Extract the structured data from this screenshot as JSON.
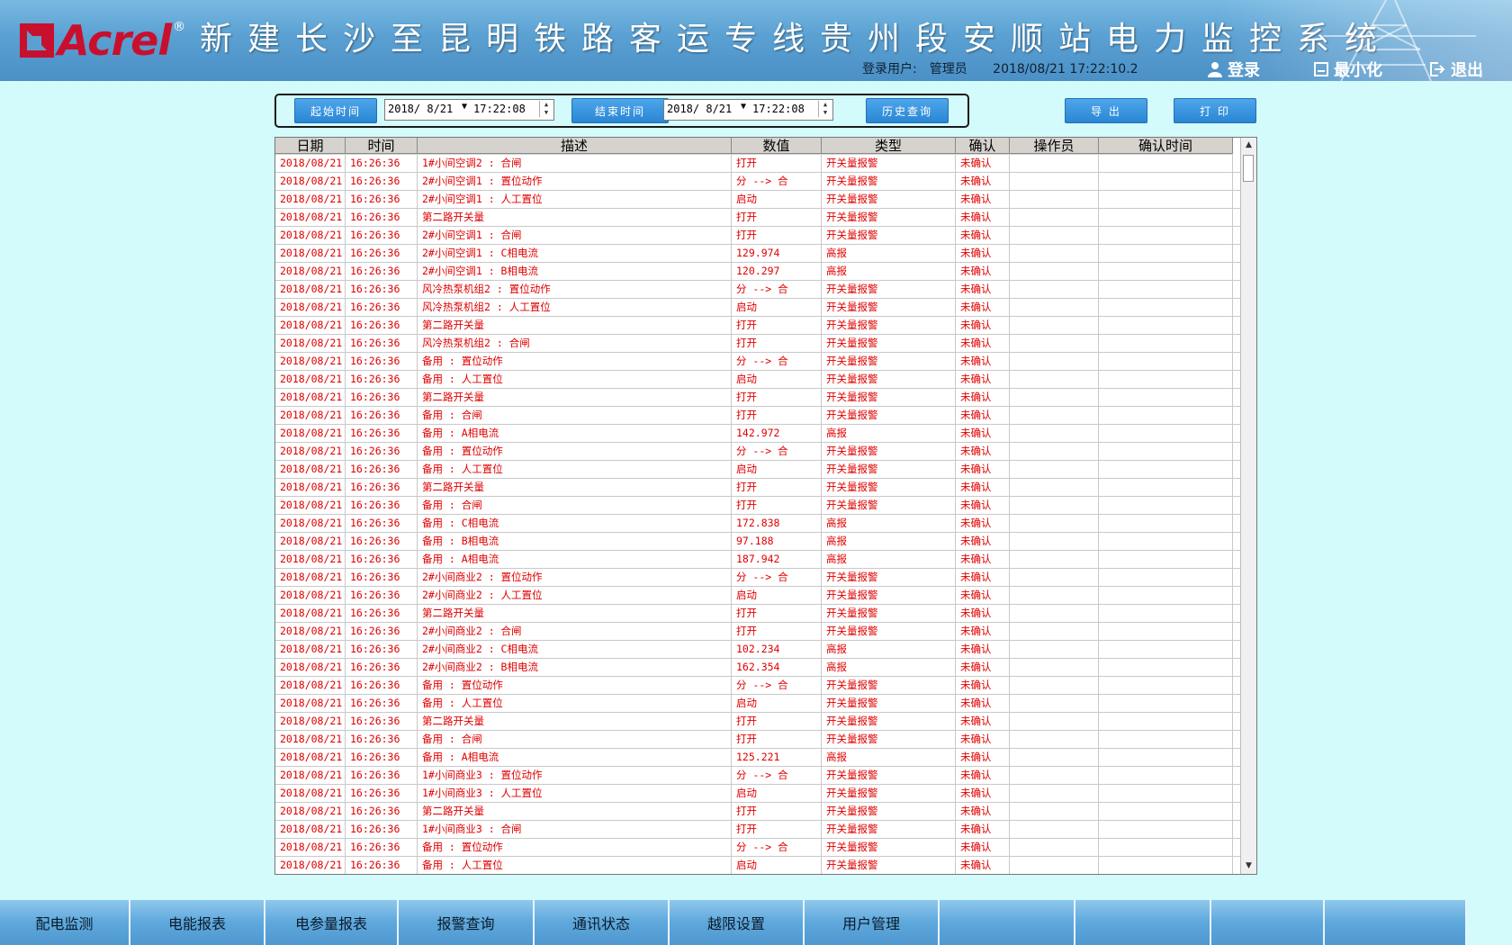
{
  "header": {
    "logo_text": "Acrel",
    "logo_reg": "®",
    "title": "新建长沙至昆明铁路客运专线贵州段安顺站电力监控系统",
    "user_label": "登录用户:",
    "user_name": "管理员",
    "datetime": "2018/08/21   17:22:10.2",
    "login_label": "登录",
    "minimize_label": "最小化",
    "exit_label": "退出"
  },
  "query": {
    "start_button": "起始时间",
    "start_date": "2018/ 8/21",
    "start_time": "17:22:08",
    "end_button": "结束时间",
    "end_date": "2018/ 8/21",
    "end_time": "17:22:08",
    "history_button": "历史查询",
    "export_button": "导 出",
    "print_button": "打 印"
  },
  "table": {
    "columns": [
      "日期",
      "时间",
      "描述",
      "数值",
      "类型",
      "确认",
      "操作员",
      "确认时间"
    ],
    "rows": [
      [
        "2018/08/21",
        "16:26:36",
        "1#小间空调2 : 合闸",
        "打开",
        "开关量报警",
        "未确认",
        "",
        ""
      ],
      [
        "2018/08/21",
        "16:26:36",
        "2#小间空调1 : 置位动作",
        "分 --> 合",
        "开关量报警",
        "未确认",
        "",
        ""
      ],
      [
        "2018/08/21",
        "16:26:36",
        "2#小间空调1 : 人工置位",
        "启动",
        "开关量报警",
        "未确认",
        "",
        ""
      ],
      [
        "2018/08/21",
        "16:26:36",
        "第二路开关量",
        "打开",
        "开关量报警",
        "未确认",
        "",
        ""
      ],
      [
        "2018/08/21",
        "16:26:36",
        "2#小间空调1 : 合闸",
        "打开",
        "开关量报警",
        "未确认",
        "",
        ""
      ],
      [
        "2018/08/21",
        "16:26:36",
        "2#小间空调1 : C相电流",
        "129.974",
        "高报",
        "未确认",
        "",
        ""
      ],
      [
        "2018/08/21",
        "16:26:36",
        "2#小间空调1 : B相电流",
        "120.297",
        "高报",
        "未确认",
        "",
        ""
      ],
      [
        "2018/08/21",
        "16:26:36",
        "风冷热泵机组2 : 置位动作",
        "分 --> 合",
        "开关量报警",
        "未确认",
        "",
        ""
      ],
      [
        "2018/08/21",
        "16:26:36",
        "风冷热泵机组2 : 人工置位",
        "启动",
        "开关量报警",
        "未确认",
        "",
        ""
      ],
      [
        "2018/08/21",
        "16:26:36",
        "第二路开关量",
        "打开",
        "开关量报警",
        "未确认",
        "",
        ""
      ],
      [
        "2018/08/21",
        "16:26:36",
        "风冷热泵机组2 : 合闸",
        "打开",
        "开关量报警",
        "未确认",
        "",
        ""
      ],
      [
        "2018/08/21",
        "16:26:36",
        "备用 : 置位动作",
        "分 --> 合",
        "开关量报警",
        "未确认",
        "",
        ""
      ],
      [
        "2018/08/21",
        "16:26:36",
        "备用 : 人工置位",
        "启动",
        "开关量报警",
        "未确认",
        "",
        ""
      ],
      [
        "2018/08/21",
        "16:26:36",
        "第二路开关量",
        "打开",
        "开关量报警",
        "未确认",
        "",
        ""
      ],
      [
        "2018/08/21",
        "16:26:36",
        "备用 : 合闸",
        "打开",
        "开关量报警",
        "未确认",
        "",
        ""
      ],
      [
        "2018/08/21",
        "16:26:36",
        "备用 : A相电流",
        "142.972",
        "高报",
        "未确认",
        "",
        ""
      ],
      [
        "2018/08/21",
        "16:26:36",
        "备用 : 置位动作",
        "分 --> 合",
        "开关量报警",
        "未确认",
        "",
        ""
      ],
      [
        "2018/08/21",
        "16:26:36",
        "备用 : 人工置位",
        "启动",
        "开关量报警",
        "未确认",
        "",
        ""
      ],
      [
        "2018/08/21",
        "16:26:36",
        "第二路开关量",
        "打开",
        "开关量报警",
        "未确认",
        "",
        ""
      ],
      [
        "2018/08/21",
        "16:26:36",
        "备用 : 合闸",
        "打开",
        "开关量报警",
        "未确认",
        "",
        ""
      ],
      [
        "2018/08/21",
        "16:26:36",
        "备用 : C相电流",
        "172.838",
        "高报",
        "未确认",
        "",
        ""
      ],
      [
        "2018/08/21",
        "16:26:36",
        "备用 : B相电流",
        "97.188",
        "高报",
        "未确认",
        "",
        ""
      ],
      [
        "2018/08/21",
        "16:26:36",
        "备用 : A相电流",
        "187.942",
        "高报",
        "未确认",
        "",
        ""
      ],
      [
        "2018/08/21",
        "16:26:36",
        "2#小间商业2 : 置位动作",
        "分 --> 合",
        "开关量报警",
        "未确认",
        "",
        ""
      ],
      [
        "2018/08/21",
        "16:26:36",
        "2#小间商业2 : 人工置位",
        "启动",
        "开关量报警",
        "未确认",
        "",
        ""
      ],
      [
        "2018/08/21",
        "16:26:36",
        "第二路开关量",
        "打开",
        "开关量报警",
        "未确认",
        "",
        ""
      ],
      [
        "2018/08/21",
        "16:26:36",
        "2#小间商业2 : 合闸",
        "打开",
        "开关量报警",
        "未确认",
        "",
        ""
      ],
      [
        "2018/08/21",
        "16:26:36",
        "2#小间商业2 : C相电流",
        "102.234",
        "高报",
        "未确认",
        "",
        ""
      ],
      [
        "2018/08/21",
        "16:26:36",
        "2#小间商业2 : B相电流",
        "162.354",
        "高报",
        "未确认",
        "",
        ""
      ],
      [
        "2018/08/21",
        "16:26:36",
        "备用 : 置位动作",
        "分 --> 合",
        "开关量报警",
        "未确认",
        "",
        ""
      ],
      [
        "2018/08/21",
        "16:26:36",
        "备用 : 人工置位",
        "启动",
        "开关量报警",
        "未确认",
        "",
        ""
      ],
      [
        "2018/08/21",
        "16:26:36",
        "第二路开关量",
        "打开",
        "开关量报警",
        "未确认",
        "",
        ""
      ],
      [
        "2018/08/21",
        "16:26:36",
        "备用 : 合闸",
        "打开",
        "开关量报警",
        "未确认",
        "",
        ""
      ],
      [
        "2018/08/21",
        "16:26:36",
        "备用 : A相电流",
        "125.221",
        "高报",
        "未确认",
        "",
        ""
      ],
      [
        "2018/08/21",
        "16:26:36",
        "1#小间商业3 : 置位动作",
        "分 --> 合",
        "开关量报警",
        "未确认",
        "",
        ""
      ],
      [
        "2018/08/21",
        "16:26:36",
        "1#小间商业3 : 人工置位",
        "启动",
        "开关量报警",
        "未确认",
        "",
        ""
      ],
      [
        "2018/08/21",
        "16:26:36",
        "第二路开关量",
        "打开",
        "开关量报警",
        "未确认",
        "",
        ""
      ],
      [
        "2018/08/21",
        "16:26:36",
        "1#小间商业3 : 合闸",
        "打开",
        "开关量报警",
        "未确认",
        "",
        ""
      ],
      [
        "2018/08/21",
        "16:26:36",
        "备用 : 置位动作",
        "分 --> 合",
        "开关量报警",
        "未确认",
        "",
        ""
      ],
      [
        "2018/08/21",
        "16:26:36",
        "备用 : 人工置位",
        "启动",
        "开关量报警",
        "未确认",
        "",
        ""
      ]
    ]
  },
  "nav": {
    "tabs": [
      "配电监测",
      "电能报表",
      "电参量报表",
      "报警查询",
      "通讯状态",
      "越限设置",
      "用户管理",
      "",
      "",
      "",
      ""
    ]
  },
  "colors": {
    "background": "#d4fbfb",
    "alarm_text": "#e00000",
    "brand_red": "#c8102e",
    "button_blue": "#2a86d4"
  }
}
